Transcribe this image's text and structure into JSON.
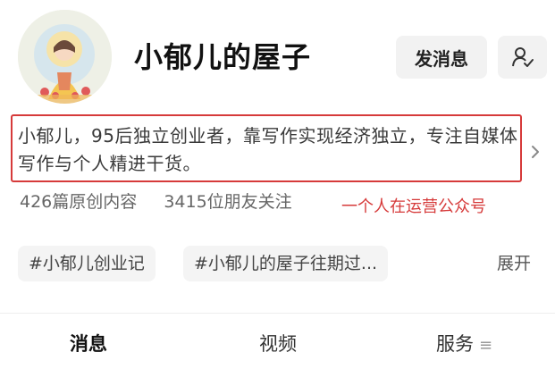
{
  "profile": {
    "name": "小郁儿的屋子",
    "message_button": "发消息",
    "follow_icon": "user-check-icon"
  },
  "intro": {
    "text": "小郁儿，95后独立创业者，靠写作实现经济独立，专注自媒体写作与个人精进干货。",
    "expand_icon": "chevron-right-icon"
  },
  "stats": {
    "articles": "426篇原创内容",
    "followers": "3415位朋友关注"
  },
  "annotation": {
    "text": "一个人在运营公众号",
    "color": "#d63a3a"
  },
  "tags": {
    "items": [
      "#小郁儿创业记",
      "#小郁儿的屋子往期过..."
    ],
    "expand_label": "展开"
  },
  "tabs": {
    "messages": "消息",
    "videos": "视频",
    "services": "服务",
    "services_icon": "menu-icon"
  }
}
